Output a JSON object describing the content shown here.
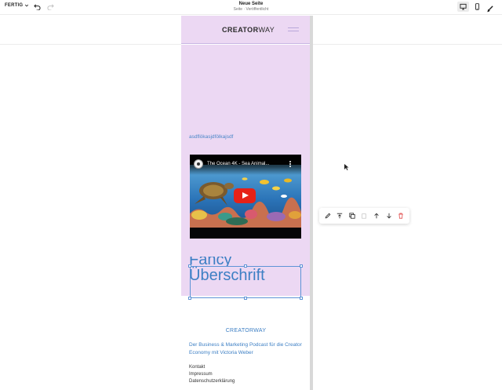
{
  "toolbar": {
    "done_label": "FERTIG",
    "page_title": "Neue Seite",
    "page_subtitle": "Seite · Veröffentlicht"
  },
  "site": {
    "logo_bold": "CREATOR",
    "logo_light": "WAY",
    "small_text": "asdflökasjdfölkajsdf",
    "video": {
      "title": "The Ocean 4K - Sea Animal..."
    },
    "heading_line1": "Fancy",
    "heading_line2": "Überschrift"
  },
  "footer": {
    "brand": "CREATORWAY",
    "description": "Der Business & Marketing Podcast für die Creator Economy mit Victoria Weber",
    "links": [
      "Kontakt",
      "Impressum",
      "Datenschutzerklärung"
    ]
  },
  "colors": {
    "section_bg": "#ecd8f3",
    "accent_blue": "#3d7fc4",
    "delete_red": "#e04b4b"
  }
}
